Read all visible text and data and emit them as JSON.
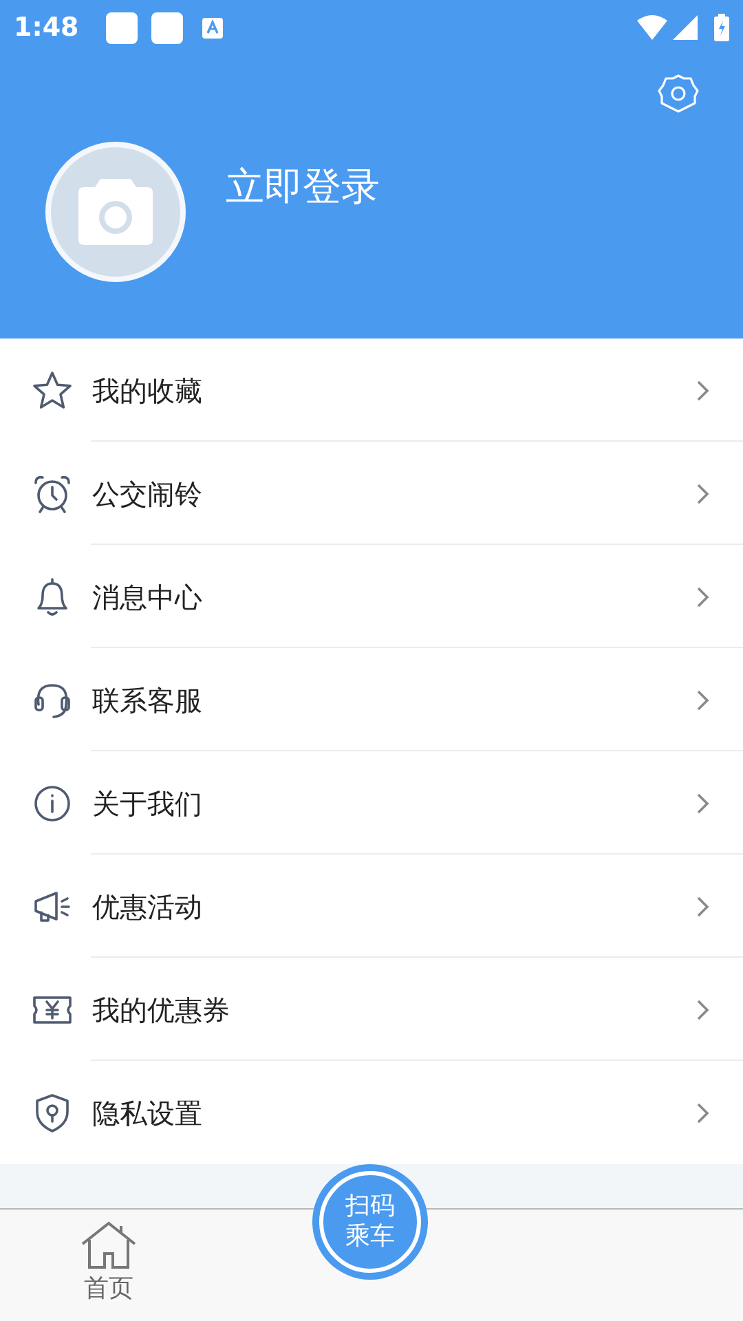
{
  "status_bar": {
    "time": "1:48"
  },
  "profile": {
    "login_label": "立即登录"
  },
  "menu": [
    {
      "label": "我的收藏"
    },
    {
      "label": "公交闹铃"
    },
    {
      "label": "消息中心"
    },
    {
      "label": "联系客服"
    },
    {
      "label": "关于我们"
    },
    {
      "label": "优惠活动"
    },
    {
      "label": "我的优惠券"
    },
    {
      "label": "隐私设置"
    }
  ],
  "bottom_nav": {
    "tabs": [
      {
        "label": "首页"
      }
    ],
    "scan_button": {
      "label_line_1": "扫码",
      "label_line_2": "乘车"
    }
  }
}
